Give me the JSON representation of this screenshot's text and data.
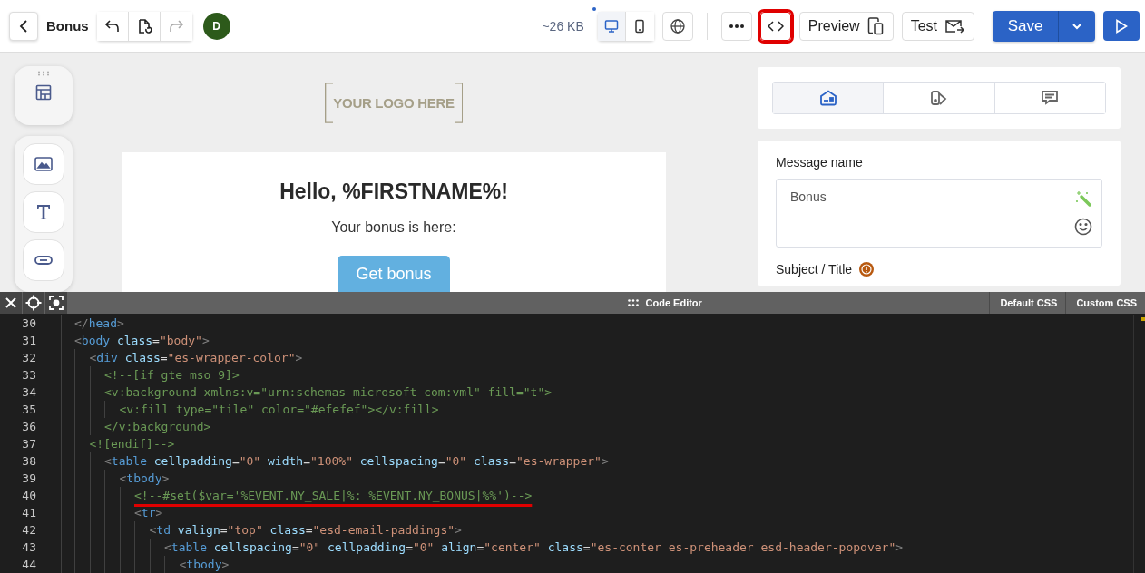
{
  "toolbar": {
    "title": "Bonus",
    "history": [
      {
        "kind": "undo",
        "disabled": false
      },
      {
        "kind": "restore",
        "disabled": false
      },
      {
        "kind": "redo",
        "disabled": true
      }
    ],
    "avatar": "D",
    "size": "~26 KB",
    "view_modes": [
      {
        "kind": "desktop",
        "selected": true
      },
      {
        "kind": "mobile",
        "selected": false
      }
    ],
    "code_button": {
      "highlighted": true
    },
    "preview": "Preview",
    "test": "Test",
    "save": "Save"
  },
  "blocks_palette": [
    {
      "kind": "structure"
    },
    {
      "kind": "image"
    },
    {
      "kind": "text"
    },
    {
      "kind": "button"
    }
  ],
  "email": {
    "logo": "YOUR LOGO HERE",
    "heading": "Hello, %FIRSTNAME%!",
    "text": "Your bonus is here:",
    "button": "Get bonus"
  },
  "settings_tabs": [
    {
      "kind": "envelope",
      "selected": true
    },
    {
      "kind": "palette",
      "selected": false
    },
    {
      "kind": "chat",
      "selected": false
    }
  ],
  "message_name": {
    "label": "Message name",
    "value": "Bonus"
  },
  "subject_label": "Subject / Title",
  "code_editor": {
    "title": "Code Editor",
    "tabs": [
      "Default CSS",
      "Custom CSS"
    ],
    "lines": [
      {
        "number": "30",
        "tokens": [
          {
            "kind": "punct",
            "t": "</"
          },
          {
            "kind": "tag",
            "t": "head"
          },
          {
            "kind": "punct",
            "t": ">"
          }
        ]
      },
      {
        "number": "31",
        "tokens": [
          {
            "kind": "punct",
            "t": "<"
          },
          {
            "kind": "tag",
            "t": "body"
          },
          {
            "kind": "attr",
            "t": " class"
          },
          {
            "kind": "op",
            "t": "="
          },
          {
            "kind": "str",
            "t": "\"body\""
          },
          {
            "kind": "punct",
            "t": ">"
          }
        ],
        "children": [
          {
            "number": "32",
            "tokens": [
              {
                "kind": "punct",
                "t": "<"
              },
              {
                "kind": "tag",
                "t": "div"
              },
              {
                "kind": "attr",
                "t": " class"
              },
              {
                "kind": "op",
                "t": "="
              },
              {
                "kind": "str",
                "t": "\"es-wrapper-color\""
              },
              {
                "kind": "punct",
                "t": ">"
              }
            ],
            "children": [
              {
                "number": "33",
                "tokens": [
                  {
                    "kind": "comment",
                    "t": "<!--[if gte mso 9]>"
                  }
                ]
              },
              {
                "number": "34",
                "tokens": [
                  {
                    "kind": "comment",
                    "t": "<v:background xmlns:v=\"urn:schemas-microsoft-com:vml\" fill=\"t\">"
                  }
                ],
                "children": [
                  {
                    "number": "35",
                    "tokens": [
                      {
                        "kind": "comment",
                        "t": "<v:fill type=\"tile\" color=\"#efefef\"></v:fill>"
                      }
                    ]
                  }
                ]
              },
              {
                "number": "36",
                "tokens": [
                  {
                    "kind": "comment",
                    "t": "</v:background>"
                  }
                ]
              }
            ]
          },
          {
            "number": "37",
            "tokens": [
              {
                "kind": "comment",
                "t": "<![endif]-->"
              }
            ],
            "children": [
              {
                "number": "38",
                "tokens": [
                  {
                    "kind": "punct",
                    "t": "<"
                  },
                  {
                    "kind": "tag",
                    "t": "table"
                  },
                  {
                    "kind": "attr",
                    "t": " cellpadding"
                  },
                  {
                    "kind": "op",
                    "t": "="
                  },
                  {
                    "kind": "str",
                    "t": "\"0\""
                  },
                  {
                    "kind": "attr",
                    "t": " width"
                  },
                  {
                    "kind": "op",
                    "t": "="
                  },
                  {
                    "kind": "str",
                    "t": "\"100%\""
                  },
                  {
                    "kind": "attr",
                    "t": " cellspacing"
                  },
                  {
                    "kind": "op",
                    "t": "="
                  },
                  {
                    "kind": "str",
                    "t": "\"0\""
                  },
                  {
                    "kind": "attr",
                    "t": " class"
                  },
                  {
                    "kind": "op",
                    "t": "="
                  },
                  {
                    "kind": "str",
                    "t": "\"es-wrapper\""
                  },
                  {
                    "kind": "punct",
                    "t": ">"
                  }
                ],
                "children": [
                  {
                    "number": "39",
                    "tokens": [
                      {
                        "kind": "punct",
                        "t": "<"
                      },
                      {
                        "kind": "tag",
                        "t": "tbody"
                      },
                      {
                        "kind": "punct",
                        "t": ">"
                      }
                    ],
                    "children": [
                      {
                        "number": "40",
                        "underlined": true,
                        "tokens": [
                          {
                            "kind": "comment",
                            "t": "<!--#set($var='%EVENT.NY_SALE|%: %EVENT.NY_BONUS|%%')-->"
                          }
                        ]
                      },
                      {
                        "number": "41",
                        "tokens": [
                          {
                            "kind": "punct",
                            "t": "<"
                          },
                          {
                            "kind": "tag",
                            "t": "tr"
                          },
                          {
                            "kind": "punct",
                            "t": ">"
                          }
                        ],
                        "children": [
                          {
                            "number": "42",
                            "tokens": [
                              {
                                "kind": "punct",
                                "t": "<"
                              },
                              {
                                "kind": "tag",
                                "t": "td"
                              },
                              {
                                "kind": "attr",
                                "t": " valign"
                              },
                              {
                                "kind": "op",
                                "t": "="
                              },
                              {
                                "kind": "str",
                                "t": "\"top\""
                              },
                              {
                                "kind": "attr",
                                "t": " class"
                              },
                              {
                                "kind": "op",
                                "t": "="
                              },
                              {
                                "kind": "str",
                                "t": "\"esd-email-paddings\""
                              },
                              {
                                "kind": "punct",
                                "t": ">"
                              }
                            ],
                            "children": [
                              {
                                "number": "43",
                                "tokens": [
                                  {
                                    "kind": "punct",
                                    "t": "<"
                                  },
                                  {
                                    "kind": "tag",
                                    "t": "table"
                                  },
                                  {
                                    "kind": "attr",
                                    "t": " cellspacing"
                                  },
                                  {
                                    "kind": "op",
                                    "t": "="
                                  },
                                  {
                                    "kind": "str",
                                    "t": "\"0\""
                                  },
                                  {
                                    "kind": "attr",
                                    "t": " cellpadding"
                                  },
                                  {
                                    "kind": "op",
                                    "t": "="
                                  },
                                  {
                                    "kind": "str",
                                    "t": "\"0\""
                                  },
                                  {
                                    "kind": "attr",
                                    "t": " align"
                                  },
                                  {
                                    "kind": "op",
                                    "t": "="
                                  },
                                  {
                                    "kind": "str",
                                    "t": "\"center\""
                                  },
                                  {
                                    "kind": "attr",
                                    "t": " class"
                                  },
                                  {
                                    "kind": "op",
                                    "t": "="
                                  },
                                  {
                                    "kind": "str",
                                    "t": "\"es-conter es-preheader esd-header-popover\""
                                  },
                                  {
                                    "kind": "punct",
                                    "t": ">"
                                  }
                                ],
                                "children": [
                                  {
                                    "number": "44",
                                    "tokens": [
                                      {
                                        "kind": "punct",
                                        "t": "<"
                                      },
                                      {
                                        "kind": "tag",
                                        "t": "tbody"
                                      },
                                      {
                                        "kind": "punct",
                                        "t": ">"
                                      }
                                    ]
                                  }
                                ]
                              }
                            ]
                          }
                        ]
                      }
                    ]
                  }
                ]
              }
            ]
          }
        ]
      }
    ]
  }
}
